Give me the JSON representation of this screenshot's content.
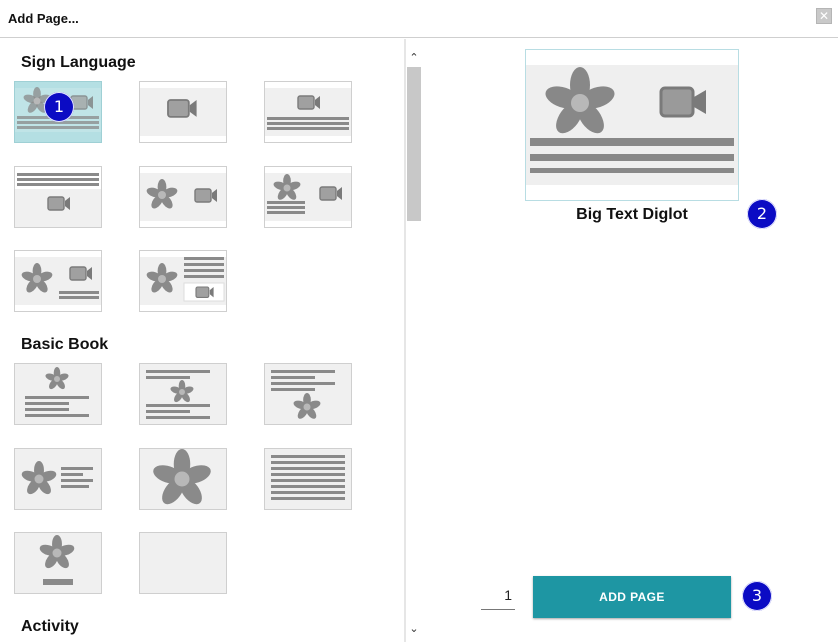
{
  "window": {
    "title": "Add Page...",
    "close_icon": "close-icon"
  },
  "sections": [
    {
      "title": "Sign Language",
      "templates": [
        {
          "layout": "picture-video-text",
          "selected": true
        },
        {
          "layout": "video-only",
          "selected": false
        },
        {
          "layout": "video-over-text",
          "selected": false
        },
        {
          "layout": "text-over-video",
          "selected": false
        },
        {
          "layout": "picture-video",
          "selected": false
        },
        {
          "layout": "picture-text-video",
          "selected": false
        },
        {
          "layout": "picture-video-small-text",
          "selected": false
        },
        {
          "layout": "picture-text-video-split",
          "selected": false
        }
      ]
    },
    {
      "title": "Basic Book",
      "templates": [
        {
          "layout": "picture-over-text",
          "selected": false
        },
        {
          "layout": "text-picture-text",
          "selected": false
        },
        {
          "layout": "text-over-picture",
          "selected": false
        },
        {
          "layout": "picture-beside-text",
          "selected": false
        },
        {
          "layout": "just-picture",
          "selected": false
        },
        {
          "layout": "just-text",
          "selected": false
        },
        {
          "layout": "picture-and-caption",
          "selected": false
        },
        {
          "layout": "blank",
          "selected": false
        }
      ]
    },
    {
      "title": "Activity",
      "templates": []
    }
  ],
  "preview": {
    "name": "Big Text Diglot"
  },
  "badges": [
    "1",
    "2",
    "3"
  ],
  "page_count": "1",
  "add_page_button": "ADD PAGE",
  "colors": {
    "accent": "#1e96a3",
    "badge": "#0b0bc4",
    "selected_tile": "#b4dfe3",
    "placeholder_gray": "#8a8a8a"
  }
}
